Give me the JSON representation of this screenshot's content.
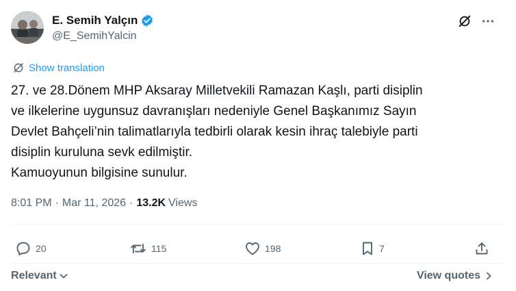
{
  "author": {
    "display_name": "E. Semih Yalçın",
    "handle": "@E_SemihYalcin"
  },
  "translate_label": "Show translation",
  "tweet_text": "27. ve 28.Dönem MHP Aksaray Milletvekili Ramazan Kaşlı, parti disiplin\nve ilkelerine uygunsuz davranışları nedeniyle Genel Başkanımız Sayın\nDevlet Bahçeli’nin talimatlarıyla tedbirli olarak kesin ihraç talebiyle parti\ndisiplin kuruluna sevk edilmiştir.\nKamuoyunun bilgisine sunulur.",
  "meta": {
    "time": "8:01 PM",
    "separator": "·",
    "date": "Mar 11, 2026",
    "views_count": "13.2K",
    "views_label": "Views"
  },
  "actions": {
    "replies": "20",
    "reposts": "115",
    "likes": "198",
    "bookmarks": "7"
  },
  "footer": {
    "sort_label": "Relevant",
    "quotes_label": "View quotes"
  },
  "colors": {
    "accent": "#1d9bf0",
    "text": "#0f1419",
    "muted": "#536471",
    "divider": "#eff3f4"
  },
  "icons": [
    "verified-badge-icon",
    "grok-icon",
    "more-icon",
    "translate-icon",
    "reply-icon",
    "repost-icon",
    "like-icon",
    "bookmark-icon",
    "share-icon",
    "chevron-down-icon",
    "chevron-right-icon"
  ]
}
